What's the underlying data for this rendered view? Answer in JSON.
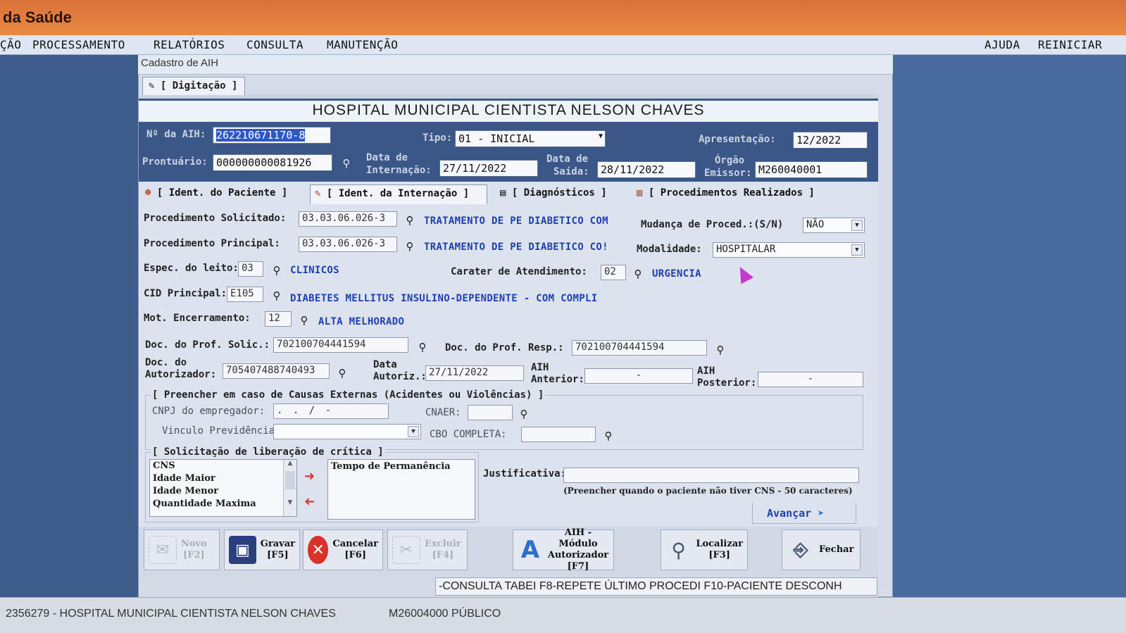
{
  "app": {
    "title": "da Saúde"
  },
  "menu": {
    "items": [
      "ÇÃO",
      "PROCESSAMENTO",
      "RELATÓRIOS",
      "CONSULTA",
      "MANUTENÇÃO"
    ],
    "right": [
      "AJUDA",
      "REINICIAR"
    ]
  },
  "window": {
    "title": "Cadastro de AIH",
    "tab": "[ Digitação ]"
  },
  "hospital_name": "HOSPITAL MUNICIPAL CIENTISTA NELSON CHAVES",
  "header": {
    "aih_label": "Nº da AIH:",
    "aih_value": "262210671170-8",
    "tipo_label": "Tipo:",
    "tipo_value": "01 - INICIAL",
    "apresentacao_label": "Apresentação:",
    "apresentacao_value": "12/2022",
    "prontuario_label": "Prontuário:",
    "prontuario_value": "000000000081926",
    "data_internacao_label_1": "Data de",
    "data_internacao_label_2": "Internação:",
    "data_internacao_value": "27/11/2022",
    "data_saida_label_1": "Data de",
    "data_saida_label_2": "Saída:",
    "data_saida_value": "28/11/2022",
    "orgao_label_1": "Órgão",
    "orgao_label_2": "Emissor:",
    "orgao_value": "M260040001"
  },
  "inner_tabs": [
    "[ Ident. do Paciente ]",
    "[ Ident. da Internação ]",
    "[ Diagnósticos ]",
    "[ Procedimentos Realizados ]"
  ],
  "form": {
    "proc_solicitado_label": "Procedimento Solicitado:",
    "proc_solicitado_code": "03.03.06.026-3",
    "proc_solicitado_desc": "TRATAMENTO DE PE DIABETICO COM",
    "mudanca_label": "Mudança de Proced.:(S/N)",
    "mudanca_value": "NÃO",
    "proc_principal_label": "Procedimento Principal:",
    "proc_principal_code": "03.03.06.026-3",
    "proc_principal_desc": "TRATAMENTO DE PE DIABETICO CO!",
    "modalidade_label": "Modalidade:",
    "modalidade_value": "HOSPITALAR",
    "espec_label": "Espec. do leito:",
    "espec_code": "03",
    "espec_desc": "CLINICOS",
    "carater_label": "Carater de Atendimento:",
    "carater_code": "02",
    "carater_desc": "URGENCIA",
    "cid_label": "CID Principal:",
    "cid_code": "E105",
    "cid_desc": "DIABETES MELLITUS INSULINO-DEPENDENTE - COM COMPLI",
    "mot_label": "Mot. Encerramento:",
    "mot_code": "12",
    "mot_desc": "ALTA MELHORADO",
    "doc_solic_label": "Doc. do Prof. Solic.:",
    "doc_solic_value": "702100704441594",
    "doc_resp_label": "Doc. do Prof. Resp.:",
    "doc_resp_value": "702100704441594",
    "doc_aut_label_1": "Doc. do",
    "doc_aut_label_2": "Autorizador:",
    "doc_aut_value": "705407488740493",
    "data_aut_label_1": "Data",
    "data_aut_label_2": "Autoriz.:",
    "data_aut_value": "27/11/2022",
    "aih_ant_label_1": "AIH",
    "aih_ant_label_2": "Anterior:",
    "aih_ant_value": "-",
    "aih_post_label_1": "AIH",
    "aih_post_label_2": "Posterior:",
    "aih_post_value": "-"
  },
  "externas": {
    "title": "[ Preencher em caso de Causas Externas (Acidentes ou Violências) ]",
    "cnpj_label": "CNPJ do empregador:",
    "cnpj_value": ". . /  -",
    "cnaer_label": "CNAER:",
    "cnaer_value": "",
    "vinculo_label": "Vinculo Previdência:",
    "vinculo_value": "",
    "cbo_label": "CBO COMPLETA:",
    "cbo_value": ""
  },
  "critica": {
    "title": "[ Solicitação de liberação de crítica ]",
    "available": [
      "CNS",
      "Idade Maior",
      "Idade Menor",
      "Quantidade Maxima"
    ],
    "selected": [
      "Tempo de Permanência"
    ],
    "justificativa_label": "Justificativa:",
    "justificativa_value": "",
    "justificativa_hint": "(Preencher quando o paciente não tiver CNS - 50 caracteres)",
    "avancar": "Avançar"
  },
  "toolbar": {
    "novo_1": "Novo",
    "novo_2": "[F2]",
    "gravar_1": "Gravar",
    "gravar_2": "[F5]",
    "cancelar_1": "Cancelar",
    "cancelar_2": "[F6]",
    "excluir_1": "Excluir",
    "excluir_2": "[F4]",
    "modulo_1": "AIH - Módulo",
    "modulo_2": "Autorizador",
    "modulo_3": "[F7]",
    "localizar_1": "Localizar",
    "localizar_2": "[F3]",
    "fechar": "Fechar"
  },
  "hint_bar": "-CONSULTA TABEI F8-REPETE ÚLTIMO PROCEDI F10-PACIENTE DESCONH",
  "footer": {
    "left": "2356279 - HOSPITAL MUNICIPAL CIENTISTA NELSON CHAVES",
    "right": "M26004000  PÚBLICO"
  },
  "colors": {
    "accent_title": "#e88a43",
    "link_blue": "#1f3fb0",
    "selection": "#2f58c4"
  }
}
